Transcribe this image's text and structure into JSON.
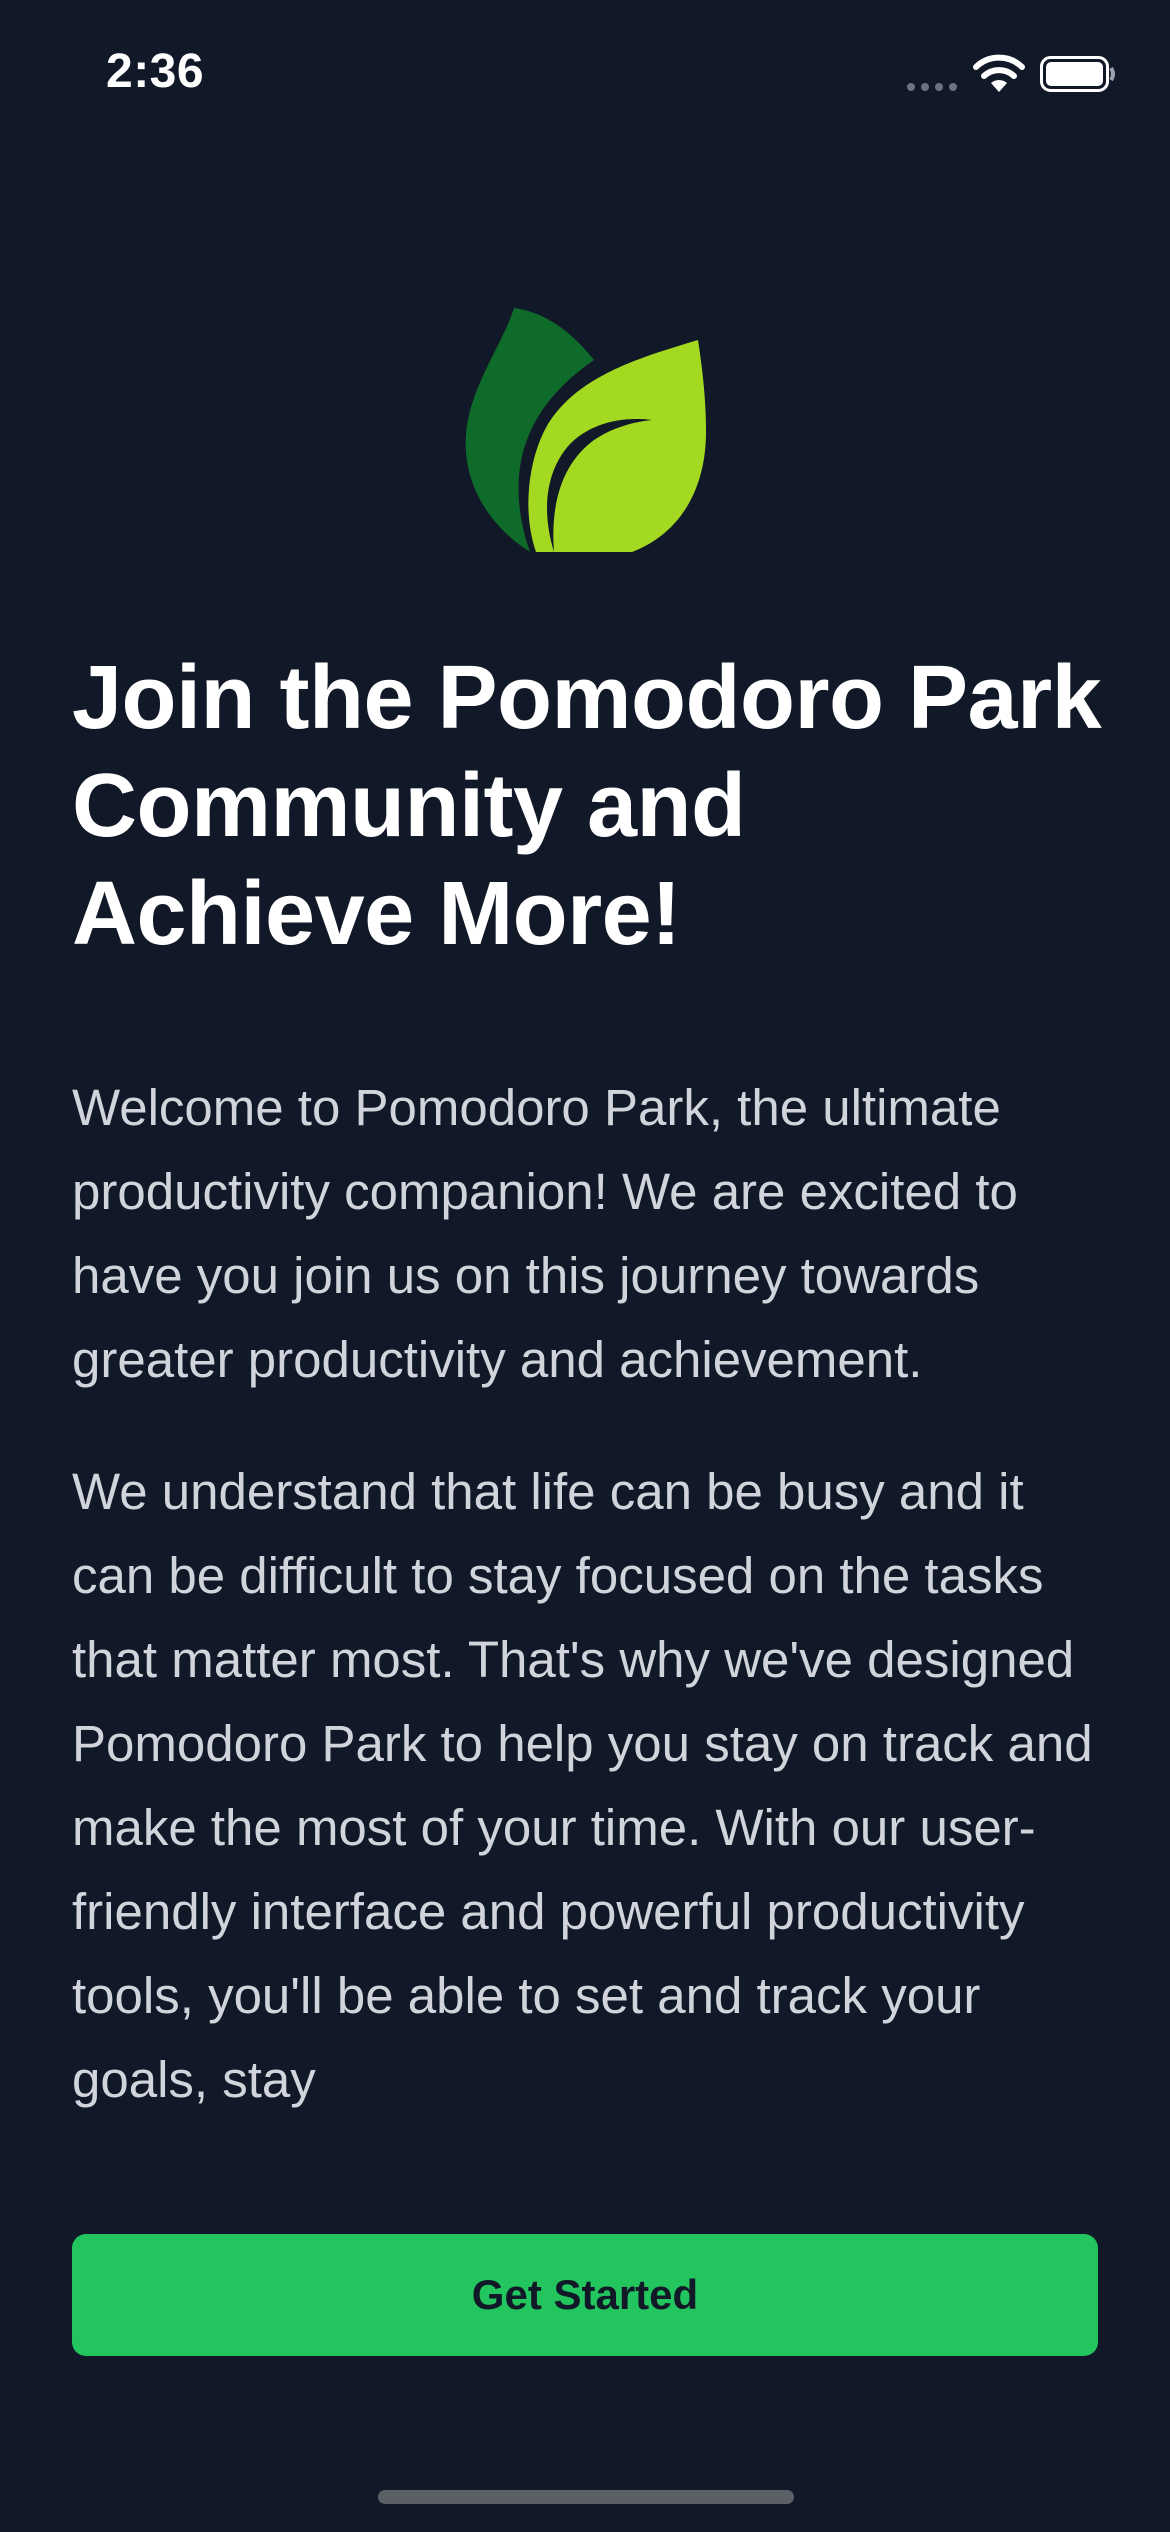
{
  "status_bar": {
    "time": "2:36"
  },
  "icons": {
    "signal": "cellular-signal-icon",
    "wifi": "wifi-icon",
    "battery": "battery-icon",
    "logo": "leaf-logo-icon"
  },
  "colors": {
    "background": "#111827",
    "accent": "#22c55e",
    "heading": "#ffffff",
    "body_text": "#d1d5db",
    "leaf_dark": "#0f6b2a",
    "leaf_light": "#a3d921"
  },
  "onboarding": {
    "heading": "Join the Pomodoro Park Community and Achieve More!",
    "paragraph_1": "Welcome to Pomodoro Park, the ultimate productivity companion! We are excited to have you join us on this journey towards greater productivity and achievement.",
    "paragraph_2": "We understand that life can be busy and it can be difficult to stay focused on the tasks that matter most. That's why we've designed Pomodoro Park to help you stay on track and make the most of your time. With our user-friendly interface and powerful productivity tools, you'll be able to set and track your goals, stay",
    "cta_label": "Get Started"
  }
}
